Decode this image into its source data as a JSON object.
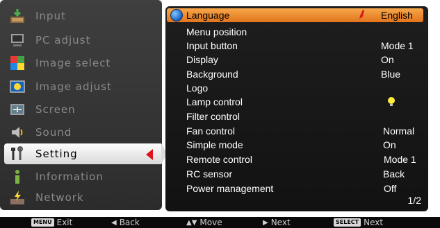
{
  "menu": {
    "items": [
      {
        "label": "Input",
        "icon": "input-icon",
        "selected": false
      },
      {
        "label": "PC adjust",
        "icon": "pc-adjust-icon",
        "selected": false
      },
      {
        "label": "Image select",
        "icon": "image-select-icon",
        "selected": false
      },
      {
        "label": "Image adjust",
        "icon": "image-adjust-icon",
        "selected": false
      },
      {
        "label": "Screen",
        "icon": "screen-icon",
        "selected": false
      },
      {
        "label": "Sound",
        "icon": "sound-icon",
        "selected": false
      },
      {
        "label": "Setting",
        "icon": "setting-icon",
        "selected": true
      },
      {
        "label": "Information",
        "icon": "information-icon",
        "selected": false
      },
      {
        "label": "Network",
        "icon": "network-icon",
        "selected": false
      }
    ]
  },
  "settings": {
    "rows": [
      {
        "label": "Language",
        "value": "English",
        "highlighted": true
      },
      {
        "label": "Menu position",
        "value": ""
      },
      {
        "label": "Input button",
        "value": "Mode 1"
      },
      {
        "label": "Display",
        "value": "On"
      },
      {
        "label": "Background",
        "value": "Blue"
      },
      {
        "label": "Logo",
        "value": ""
      },
      {
        "label": "Lamp control",
        "value": "",
        "icon": "lamp-bulb-icon"
      },
      {
        "label": "Filter control",
        "value": ""
      },
      {
        "label": "Fan control",
        "value": "Normal"
      },
      {
        "label": "Simple mode",
        "value": "On"
      },
      {
        "label": "Remote control",
        "value": "Mode 1"
      },
      {
        "label": "RC sensor",
        "value": "Back"
      },
      {
        "label": "Power management",
        "value": "Off"
      }
    ],
    "page": "1/2"
  },
  "guide": {
    "exit_key": "MENU",
    "exit": "Exit",
    "back": "Back",
    "move": "Move",
    "next": "Next",
    "select_key": "SELECT",
    "select_next": "Next"
  },
  "colors": {
    "highlight": "#f0902f",
    "selection_arrow": "#e0141e",
    "panel_bg": "#1a1a1a"
  }
}
